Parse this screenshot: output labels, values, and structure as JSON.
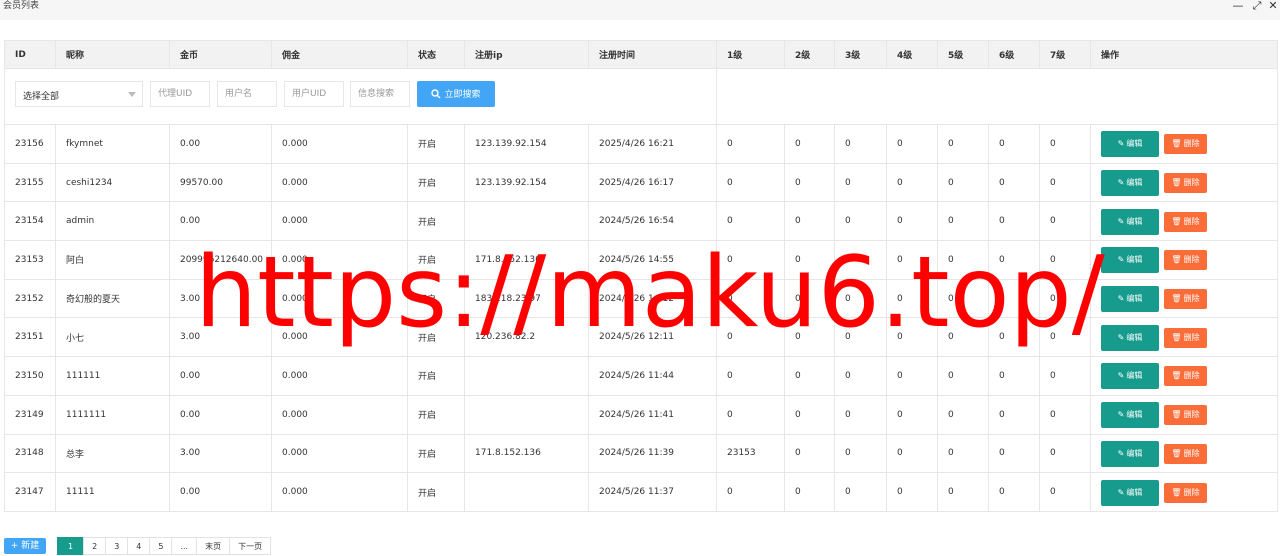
{
  "window": {
    "title": "会员列表",
    "minimize": "—",
    "maximize": "⤢",
    "close": "✕"
  },
  "columns": [
    "ID",
    "昵称",
    "金币",
    "佣金",
    "状态",
    "注册ip",
    "注册时间",
    "1级",
    "2级",
    "3级",
    "4级",
    "5级",
    "6级",
    "7级",
    "操作"
  ],
  "filter": {
    "select_value": "选择全部",
    "agent_uid_placeholder": "代理UID",
    "username_placeholder": "用户名",
    "user_uid_placeholder": "用户UID",
    "info_search_placeholder": "信息搜索",
    "search_button": "立即搜索"
  },
  "rows": [
    {
      "id": "23156",
      "nick": "fkymnet",
      "gold": "0.00",
      "commission": "0.000",
      "status": "开启",
      "ip": "123.139.92.154",
      "time": "2025/4/26 16:21",
      "l1": "0",
      "l2": "0",
      "l3": "0",
      "l4": "0",
      "l5": "0",
      "l6": "0",
      "l7": "0"
    },
    {
      "id": "23155",
      "nick": "ceshi1234",
      "gold": "99570.00",
      "commission": "0.000",
      "status": "开启",
      "ip": "123.139.92.154",
      "time": "2025/4/26 16:17",
      "l1": "0",
      "l2": "0",
      "l3": "0",
      "l4": "0",
      "l5": "0",
      "l6": "0",
      "l7": "0"
    },
    {
      "id": "23154",
      "nick": "admin",
      "gold": "0.00",
      "commission": "0.000",
      "status": "开启",
      "ip": "",
      "time": "2024/5/26 16:54",
      "l1": "0",
      "l2": "0",
      "l3": "0",
      "l4": "0",
      "l5": "0",
      "l6": "0",
      "l7": "0"
    },
    {
      "id": "23153",
      "nick": "阿白",
      "gold": "209996212640.00",
      "commission": "0.000",
      "status": "开启",
      "ip": "171.8.152.136",
      "time": "2024/5/26 14:55",
      "l1": "0",
      "l2": "0",
      "l3": "0",
      "l4": "0",
      "l5": "0",
      "l6": "0",
      "l7": "0"
    },
    {
      "id": "23152",
      "nick": "奇幻般的夏天",
      "gold": "3.00",
      "commission": "0.000",
      "status": "开启",
      "ip": "183.118.23.97",
      "time": "2024/5/26 14:12",
      "l1": "0",
      "l2": "0",
      "l3": "0",
      "l4": "0",
      "l5": "0",
      "l6": "0",
      "l7": "0"
    },
    {
      "id": "23151",
      "nick": "小七",
      "gold": "3.00",
      "commission": "0.000",
      "status": "开启",
      "ip": "120.236.82.2",
      "time": "2024/5/26 12:11",
      "l1": "0",
      "l2": "0",
      "l3": "0",
      "l4": "0",
      "l5": "0",
      "l6": "0",
      "l7": "0"
    },
    {
      "id": "23150",
      "nick": "111111",
      "gold": "0.00",
      "commission": "0.000",
      "status": "开启",
      "ip": "",
      "time": "2024/5/26 11:44",
      "l1": "0",
      "l2": "0",
      "l3": "0",
      "l4": "0",
      "l5": "0",
      "l6": "0",
      "l7": "0"
    },
    {
      "id": "23149",
      "nick": "1111111",
      "gold": "0.00",
      "commission": "0.000",
      "status": "开启",
      "ip": "",
      "time": "2024/5/26 11:41",
      "l1": "0",
      "l2": "0",
      "l3": "0",
      "l4": "0",
      "l5": "0",
      "l6": "0",
      "l7": "0"
    },
    {
      "id": "23148",
      "nick": "总李",
      "gold": "3.00",
      "commission": "0.000",
      "status": "开启",
      "ip": "171.8.152.136",
      "time": "2024/5/26 11:39",
      "l1": "23153",
      "l2": "0",
      "l3": "0",
      "l4": "0",
      "l5": "0",
      "l6": "0",
      "l7": "0"
    },
    {
      "id": "23147",
      "nick": "11111",
      "gold": "0.00",
      "commission": "0.000",
      "status": "开启",
      "ip": "",
      "time": "2024/5/26 11:37",
      "l1": "0",
      "l2": "0",
      "l3": "0",
      "l4": "0",
      "l5": "0",
      "l6": "0",
      "l7": "0"
    }
  ],
  "actions": {
    "edit": "编辑",
    "delete": "删除",
    "edit_icon": "pencil-icon",
    "delete_icon": "trash-icon"
  },
  "new_button": "+ 新建",
  "pagination": [
    "1",
    "2",
    "3",
    "4",
    "5",
    "...",
    "末页",
    "下一页"
  ],
  "current_page": "1",
  "watermark": "https://maku6.top/",
  "colors": {
    "accent": "#42a5f5",
    "edit": "#169b8c",
    "delete": "#fa6c38",
    "status_on": "#2fa02f",
    "watermark": "#ff0000"
  }
}
